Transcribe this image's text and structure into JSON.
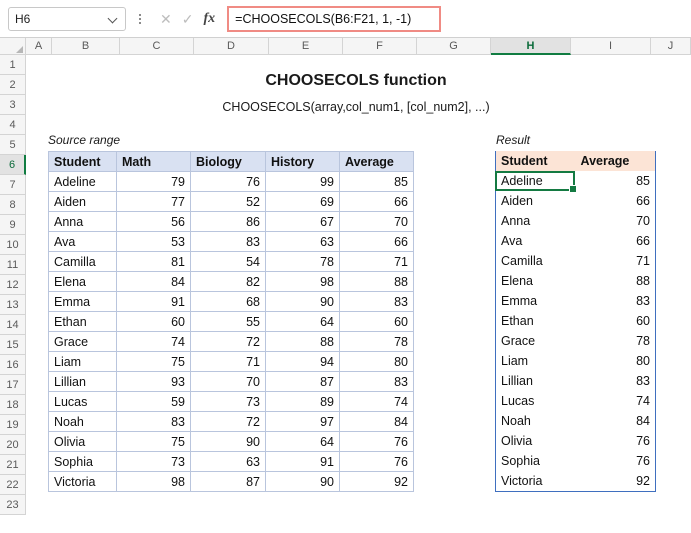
{
  "formula_bar": {
    "name_box_value": "H6",
    "formula": "=CHOOSECOLS(B6:F21, 1, -1)",
    "cancel_icon": "cancel-icon",
    "confirm_icon": "confirm-icon",
    "fx_label": "fx"
  },
  "grid": {
    "columns": [
      "A",
      "B",
      "C",
      "D",
      "E",
      "F",
      "G",
      "H",
      "I",
      "J"
    ],
    "selected_column": "H",
    "rows": [
      "1",
      "2",
      "3",
      "4",
      "5",
      "6",
      "7",
      "8",
      "9",
      "10",
      "11",
      "12",
      "13",
      "14",
      "15",
      "16",
      "17",
      "18",
      "19",
      "20",
      "21",
      "22",
      "23"
    ],
    "selected_row": "6"
  },
  "sheet": {
    "title": "CHOOSECOLS function",
    "syntax": "CHOOSECOLS(array,col_num1, [col_num2], ...)",
    "source_label": "Source range",
    "result_label": "Result"
  },
  "source_table": {
    "headers": [
      "Student",
      "Math",
      "Biology",
      "History",
      "Average"
    ],
    "rows": [
      [
        "Adeline",
        "79",
        "76",
        "99",
        "85"
      ],
      [
        "Aiden",
        "77",
        "52",
        "69",
        "66"
      ],
      [
        "Anna",
        "56",
        "86",
        "67",
        "70"
      ],
      [
        "Ava",
        "53",
        "83",
        "63",
        "66"
      ],
      [
        "Camilla",
        "81",
        "54",
        "78",
        "71"
      ],
      [
        "Elena",
        "84",
        "82",
        "98",
        "88"
      ],
      [
        "Emma",
        "91",
        "68",
        "90",
        "83"
      ],
      [
        "Ethan",
        "60",
        "55",
        "64",
        "60"
      ],
      [
        "Grace",
        "74",
        "72",
        "88",
        "78"
      ],
      [
        "Liam",
        "75",
        "71",
        "94",
        "80"
      ],
      [
        "Lillian",
        "93",
        "70",
        "87",
        "83"
      ],
      [
        "Lucas",
        "59",
        "73",
        "89",
        "74"
      ],
      [
        "Noah",
        "83",
        "72",
        "97",
        "84"
      ],
      [
        "Olivia",
        "75",
        "90",
        "64",
        "76"
      ],
      [
        "Sophia",
        "73",
        "63",
        "91",
        "76"
      ],
      [
        "Victoria",
        "98",
        "87",
        "90",
        "92"
      ]
    ]
  },
  "result_table": {
    "headers": [
      "Student",
      "Average"
    ],
    "rows": [
      [
        "Adeline",
        "85"
      ],
      [
        "Aiden",
        "66"
      ],
      [
        "Anna",
        "70"
      ],
      [
        "Ava",
        "66"
      ],
      [
        "Camilla",
        "71"
      ],
      [
        "Elena",
        "88"
      ],
      [
        "Emma",
        "83"
      ],
      [
        "Ethan",
        "60"
      ],
      [
        "Grace",
        "78"
      ],
      [
        "Liam",
        "80"
      ],
      [
        "Lillian",
        "83"
      ],
      [
        "Lucas",
        "74"
      ],
      [
        "Noah",
        "84"
      ],
      [
        "Olivia",
        "76"
      ],
      [
        "Sophia",
        "76"
      ],
      [
        "Victoria",
        "92"
      ]
    ]
  },
  "colors": {
    "source_header_fill": "#d9e1f2",
    "result_header_fill": "#fce4d6",
    "active_cell_border": "#147a42",
    "spill_border": "#3f6fbf",
    "formula_highlight": "#f08b84"
  }
}
